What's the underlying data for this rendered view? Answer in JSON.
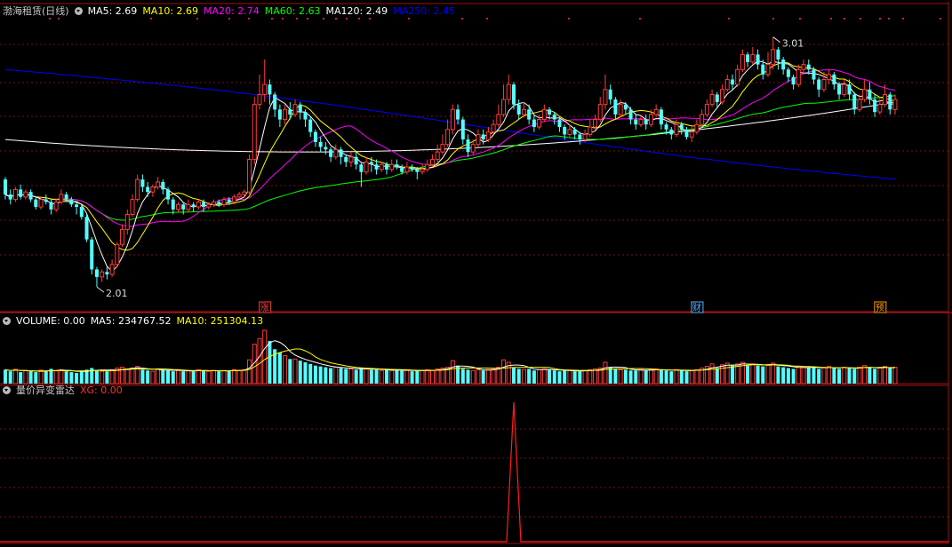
{
  "price_panel": {
    "stock_name": "渤海租赁(日线)",
    "indicators": [
      {
        "label": "MA5: 2.69",
        "color": "#ffffff"
      },
      {
        "label": "MA10: 2.69",
        "color": "#ffff00"
      },
      {
        "label": "MA20: 2.74",
        "color": "#ff00ff"
      },
      {
        "label": "MA60: 2.63",
        "color": "#00ff00"
      },
      {
        "label": "MA120: 2.49",
        "color": "#ffffff"
      },
      {
        "label": "MA250: 2.45",
        "color": "#0000ff"
      }
    ],
    "markers": [
      {
        "label": "涨",
        "bar": 51,
        "color": "#ff4040"
      },
      {
        "label": "财",
        "bar": 136,
        "color": "#5ab4ff"
      },
      {
        "label": "预",
        "bar": 172,
        "color": "#ff9a00"
      }
    ],
    "high_annotation": "3.01",
    "low_annotation": "2.01"
  },
  "volume_panel": {
    "indicators": [
      {
        "label": "VOLUME: 0.00",
        "color": "#ffffff"
      },
      {
        "label": "MA5: 234767.52",
        "color": "#ffffff"
      },
      {
        "label": "MA10: 251304.13",
        "color": "#ffff00"
      }
    ]
  },
  "radar_panel": {
    "title": "量价异变雷达",
    "indicators": [
      {
        "label": "XG: 0.00",
        "color": "#ff3030"
      }
    ]
  },
  "chart_data": {
    "type": "candlestick",
    "colors": {
      "up": "#ff3c3c",
      "down": "#54ffff",
      "ma5": "#ffffff",
      "ma10": "#ffff00",
      "ma20": "#ff00ff",
      "ma60": "#00ff00",
      "ma120": "#ffffff",
      "ma250": "#0000ff",
      "signal": "#ff2020"
    },
    "price_range": [
      1.95,
      3.08
    ],
    "high": 3.01,
    "low": 2.01,
    "last_values": {
      "ma5": 2.69,
      "ma10": 2.69,
      "ma20": 2.74,
      "ma60": 2.63,
      "ma120": 2.49,
      "ma250": 2.45
    },
    "signal_bar": 100,
    "candles": [
      [
        2.44,
        2.38,
        2.45,
        2.36
      ],
      [
        2.38,
        2.36,
        2.4,
        2.34
      ],
      [
        2.36,
        2.4,
        2.41,
        2.35
      ],
      [
        2.4,
        2.37,
        2.42,
        2.36
      ],
      [
        2.37,
        2.39,
        2.4,
        2.36
      ],
      [
        2.39,
        2.36,
        2.4,
        2.35
      ],
      [
        2.36,
        2.33,
        2.37,
        2.32
      ],
      [
        2.33,
        2.36,
        2.37,
        2.32
      ],
      [
        2.36,
        2.35,
        2.38,
        2.34
      ],
      [
        2.35,
        2.32,
        2.36,
        2.3
      ],
      [
        2.32,
        2.35,
        2.36,
        2.31
      ],
      [
        2.35,
        2.38,
        2.4,
        2.34
      ],
      [
        2.38,
        2.36,
        2.39,
        2.35
      ],
      [
        2.36,
        2.34,
        2.37,
        2.33
      ],
      [
        2.34,
        2.33,
        2.35,
        2.3
      ],
      [
        2.33,
        2.29,
        2.34,
        2.28
      ],
      [
        2.29,
        2.2,
        2.3,
        2.19
      ],
      [
        2.2,
        2.08,
        2.21,
        2.06
      ],
      [
        2.08,
        2.05,
        2.09,
        2.01
      ],
      [
        2.05,
        2.07,
        2.08,
        2.03
      ],
      [
        2.07,
        2.06,
        2.09,
        2.04
      ],
      [
        2.06,
        2.1,
        2.12,
        2.05
      ],
      [
        2.1,
        2.18,
        2.19,
        2.09
      ],
      [
        2.18,
        2.24,
        2.26,
        2.17
      ],
      [
        2.24,
        2.3,
        2.32,
        2.22
      ],
      [
        2.3,
        2.36,
        2.38,
        2.29
      ],
      [
        2.36,
        2.44,
        2.46,
        2.35
      ],
      [
        2.44,
        2.41,
        2.46,
        2.39
      ],
      [
        2.41,
        2.39,
        2.43,
        2.37
      ],
      [
        2.39,
        2.41,
        2.42,
        2.37
      ],
      [
        2.41,
        2.43,
        2.45,
        2.4
      ],
      [
        2.43,
        2.4,
        2.44,
        2.38
      ],
      [
        2.4,
        2.36,
        2.41,
        2.34
      ],
      [
        2.36,
        2.32,
        2.37,
        2.3
      ],
      [
        2.32,
        2.34,
        2.35,
        2.31
      ],
      [
        2.34,
        2.32,
        2.35,
        2.3
      ],
      [
        2.32,
        2.34,
        2.36,
        2.31
      ],
      [
        2.34,
        2.33,
        2.35,
        2.31
      ],
      [
        2.33,
        2.35,
        2.36,
        2.32
      ],
      [
        2.35,
        2.33,
        2.36,
        2.31
      ],
      [
        2.33,
        2.34,
        2.35,
        2.32
      ],
      [
        2.34,
        2.35,
        2.36,
        2.33
      ],
      [
        2.35,
        2.34,
        2.36,
        2.33
      ],
      [
        2.34,
        2.36,
        2.37,
        2.33
      ],
      [
        2.36,
        2.35,
        2.37,
        2.34
      ],
      [
        2.35,
        2.37,
        2.38,
        2.34
      ],
      [
        2.37,
        2.38,
        2.39,
        2.36
      ],
      [
        2.38,
        2.39,
        2.4,
        2.37
      ],
      [
        2.39,
        2.52,
        2.54,
        2.38
      ],
      [
        2.52,
        2.74,
        2.77,
        2.5
      ],
      [
        2.74,
        2.78,
        2.86,
        2.72
      ],
      [
        2.78,
        2.82,
        2.92,
        2.75
      ],
      [
        2.82,
        2.78,
        2.84,
        2.74
      ],
      [
        2.78,
        2.72,
        2.79,
        2.69
      ],
      [
        2.72,
        2.68,
        2.74,
        2.65
      ],
      [
        2.68,
        2.72,
        2.74,
        2.66
      ],
      [
        2.72,
        2.7,
        2.75,
        2.68
      ],
      [
        2.7,
        2.74,
        2.76,
        2.69
      ],
      [
        2.74,
        2.71,
        2.75,
        2.68
      ],
      [
        2.71,
        2.68,
        2.72,
        2.65
      ],
      [
        2.68,
        2.63,
        2.69,
        2.61
      ],
      [
        2.63,
        2.59,
        2.64,
        2.57
      ],
      [
        2.59,
        2.57,
        2.61,
        2.55
      ],
      [
        2.57,
        2.56,
        2.59,
        2.54
      ],
      [
        2.56,
        2.53,
        2.57,
        2.51
      ],
      [
        2.53,
        2.56,
        2.58,
        2.52
      ],
      [
        2.56,
        2.53,
        2.57,
        2.5
      ],
      [
        2.53,
        2.51,
        2.54,
        2.49
      ],
      [
        2.51,
        2.53,
        2.55,
        2.49
      ],
      [
        2.53,
        2.5,
        2.55,
        2.48
      ],
      [
        2.5,
        2.47,
        2.51,
        2.41
      ],
      [
        2.47,
        2.51,
        2.53,
        2.46
      ],
      [
        2.51,
        2.5,
        2.53,
        2.47
      ],
      [
        2.5,
        2.48,
        2.52,
        2.46
      ],
      [
        2.48,
        2.5,
        2.51,
        2.47
      ],
      [
        2.5,
        2.48,
        2.51,
        2.46
      ],
      [
        2.48,
        2.5,
        2.52,
        2.47
      ],
      [
        2.5,
        2.49,
        2.52,
        2.48
      ],
      [
        2.49,
        2.47,
        2.5,
        2.46
      ],
      [
        2.47,
        2.49,
        2.51,
        2.46
      ],
      [
        2.49,
        2.48,
        2.5,
        2.47
      ],
      [
        2.48,
        2.47,
        2.49,
        2.44
      ],
      [
        2.47,
        2.48,
        2.5,
        2.46
      ],
      [
        2.48,
        2.5,
        2.52,
        2.47
      ],
      [
        2.5,
        2.52,
        2.54,
        2.49
      ],
      [
        2.52,
        2.55,
        2.58,
        2.51
      ],
      [
        2.55,
        2.58,
        2.62,
        2.54
      ],
      [
        2.58,
        2.64,
        2.68,
        2.57
      ],
      [
        2.64,
        2.72,
        2.74,
        2.62
      ],
      [
        2.72,
        2.68,
        2.74,
        2.66
      ],
      [
        2.68,
        2.6,
        2.69,
        2.58
      ],
      [
        2.6,
        2.55,
        2.62,
        2.53
      ],
      [
        2.55,
        2.58,
        2.6,
        2.54
      ],
      [
        2.58,
        2.62,
        2.64,
        2.57
      ],
      [
        2.62,
        2.6,
        2.64,
        2.58
      ],
      [
        2.6,
        2.63,
        2.65,
        2.59
      ],
      [
        2.63,
        2.66,
        2.68,
        2.62
      ],
      [
        2.66,
        2.7,
        2.74,
        2.65
      ],
      [
        2.7,
        2.76,
        2.82,
        2.69
      ],
      [
        2.76,
        2.82,
        2.86,
        2.74
      ],
      [
        2.82,
        2.74,
        2.83,
        2.72
      ],
      [
        2.74,
        2.7,
        2.76,
        2.68
      ],
      [
        2.7,
        2.72,
        2.75,
        2.69
      ],
      [
        2.72,
        2.68,
        2.74,
        2.66
      ],
      [
        2.68,
        2.65,
        2.7,
        2.63
      ],
      [
        2.65,
        2.68,
        2.7,
        2.64
      ],
      [
        2.68,
        2.72,
        2.74,
        2.67
      ],
      [
        2.72,
        2.7,
        2.73,
        2.68
      ],
      [
        2.7,
        2.68,
        2.71,
        2.66
      ],
      [
        2.68,
        2.65,
        2.69,
        2.63
      ],
      [
        2.65,
        2.62,
        2.66,
        2.6
      ],
      [
        2.62,
        2.64,
        2.66,
        2.61
      ],
      [
        2.64,
        2.62,
        2.65,
        2.6
      ],
      [
        2.62,
        2.6,
        2.63,
        2.58
      ],
      [
        2.6,
        2.62,
        2.64,
        2.59
      ],
      [
        2.62,
        2.65,
        2.68,
        2.61
      ],
      [
        2.65,
        2.68,
        2.7,
        2.64
      ],
      [
        2.68,
        2.74,
        2.77,
        2.67
      ],
      [
        2.74,
        2.8,
        2.86,
        2.72
      ],
      [
        2.8,
        2.76,
        2.82,
        2.74
      ],
      [
        2.76,
        2.7,
        2.77,
        2.68
      ],
      [
        2.7,
        2.74,
        2.76,
        2.69
      ],
      [
        2.74,
        2.72,
        2.75,
        2.7
      ],
      [
        2.72,
        2.68,
        2.73,
        2.66
      ],
      [
        2.68,
        2.66,
        2.7,
        2.64
      ],
      [
        2.66,
        2.68,
        2.7,
        2.65
      ],
      [
        2.68,
        2.66,
        2.7,
        2.64
      ],
      [
        2.66,
        2.7,
        2.72,
        2.65
      ],
      [
        2.7,
        2.72,
        2.74,
        2.69
      ],
      [
        2.72,
        2.66,
        2.73,
        2.64
      ],
      [
        2.66,
        2.64,
        2.67,
        2.62
      ],
      [
        2.64,
        2.62,
        2.65,
        2.6
      ],
      [
        2.62,
        2.66,
        2.68,
        2.61
      ],
      [
        2.66,
        2.64,
        2.67,
        2.62
      ],
      [
        2.64,
        2.61,
        2.65,
        2.6
      ],
      [
        2.61,
        2.63,
        2.65,
        2.59
      ],
      [
        2.63,
        2.66,
        2.68,
        2.62
      ],
      [
        2.66,
        2.7,
        2.72,
        2.65
      ],
      [
        2.7,
        2.74,
        2.76,
        2.69
      ],
      [
        2.74,
        2.78,
        2.8,
        2.73
      ],
      [
        2.78,
        2.75,
        2.79,
        2.73
      ],
      [
        2.75,
        2.8,
        2.82,
        2.74
      ],
      [
        2.8,
        2.84,
        2.86,
        2.79
      ],
      [
        2.84,
        2.82,
        2.86,
        2.8
      ],
      [
        2.82,
        2.88,
        2.9,
        2.81
      ],
      [
        2.88,
        2.94,
        2.96,
        2.87
      ],
      [
        2.94,
        2.91,
        2.95,
        2.89
      ],
      [
        2.91,
        2.94,
        2.97,
        2.9
      ],
      [
        2.94,
        2.9,
        2.96,
        2.88
      ],
      [
        2.9,
        2.86,
        2.92,
        2.84
      ],
      [
        2.86,
        2.9,
        2.95,
        2.85
      ],
      [
        2.9,
        2.96,
        3.01,
        2.88
      ],
      [
        2.96,
        2.92,
        2.97,
        2.88
      ],
      [
        2.92,
        2.88,
        2.93,
        2.86
      ],
      [
        2.88,
        2.85,
        2.89,
        2.83
      ],
      [
        2.85,
        2.82,
        2.86,
        2.8
      ],
      [
        2.82,
        2.88,
        2.9,
        2.81
      ],
      [
        2.88,
        2.9,
        2.92,
        2.86
      ],
      [
        2.9,
        2.88,
        2.92,
        2.86
      ],
      [
        2.88,
        2.84,
        2.89,
        2.82
      ],
      [
        2.84,
        2.8,
        2.85,
        2.77
      ],
      [
        2.8,
        2.84,
        2.87,
        2.79
      ],
      [
        2.84,
        2.86,
        2.88,
        2.82
      ],
      [
        2.86,
        2.82,
        2.87,
        2.8
      ],
      [
        2.82,
        2.78,
        2.83,
        2.76
      ],
      [
        2.78,
        2.82,
        2.84,
        2.77
      ],
      [
        2.82,
        2.78,
        2.84,
        2.76
      ],
      [
        2.78,
        2.72,
        2.79,
        2.7
      ],
      [
        2.72,
        2.76,
        2.78,
        2.71
      ],
      [
        2.76,
        2.8,
        2.84,
        2.75
      ],
      [
        2.8,
        2.76,
        2.83,
        2.74
      ],
      [
        2.76,
        2.71,
        2.78,
        2.69
      ],
      [
        2.71,
        2.74,
        2.77,
        2.7
      ],
      [
        2.74,
        2.78,
        2.82,
        2.73
      ],
      [
        2.78,
        2.72,
        2.79,
        2.7
      ],
      [
        2.72,
        2.76,
        2.78,
        2.7
      ]
    ],
    "volume": [
      170,
      150,
      175,
      140,
      160,
      150,
      140,
      165,
      150,
      180,
      160,
      170,
      150,
      140,
      130,
      160,
      170,
      190,
      165,
      150,
      150,
      170,
      190,
      200,
      180,
      190,
      210,
      170,
      160,
      150,
      180,
      170,
      160,
      150,
      160,
      150,
      160,
      150,
      170,
      160,
      150,
      160,
      150,
      160,
      160,
      170,
      160,
      170,
      290,
      480,
      550,
      650,
      520,
      420,
      380,
      340,
      300,
      300,
      280,
      260,
      240,
      220,
      210,
      200,
      190,
      200,
      190,
      180,
      180,
      170,
      190,
      180,
      170,
      170,
      160,
      170,
      160,
      170,
      160,
      160,
      150,
      160,
      160,
      170,
      160,
      180,
      190,
      200,
      280,
      220,
      180,
      170,
      160,
      170,
      160,
      170,
      180,
      200,
      290,
      260,
      200,
      180,
      170,
      180,
      160,
      170,
      180,
      170,
      160,
      150,
      160,
      160,
      150,
      150,
      160,
      170,
      180,
      190,
      260,
      200,
      180,
      170,
      170,
      160,
      160,
      170,
      160,
      170,
      180,
      170,
      160,
      150,
      170,
      160,
      150,
      160,
      170,
      190,
      210,
      240,
      190,
      230,
      250,
      220,
      240,
      260,
      220,
      240,
      220,
      210,
      230,
      250,
      210,
      200,
      190,
      180,
      210,
      200,
      200,
      190,
      180,
      200,
      210,
      190,
      180,
      200,
      190,
      180,
      200,
      220,
      200,
      180,
      190,
      210,
      190,
      200
    ]
  }
}
